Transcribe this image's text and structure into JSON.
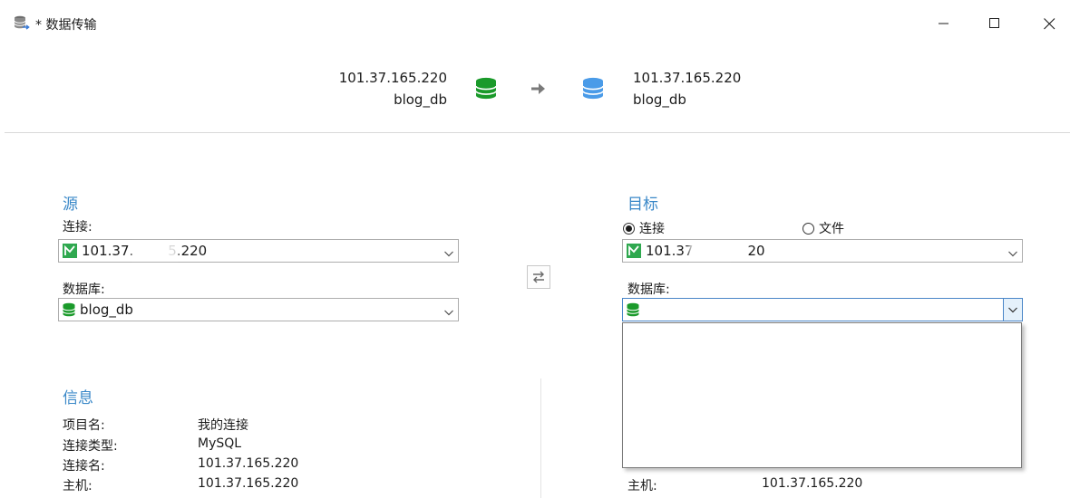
{
  "window": {
    "title": "* 数据传输",
    "minimize_glyph": "—",
    "maximize_glyph": "☐",
    "close_glyph": "✕"
  },
  "header": {
    "source_host": "101.37.165.220",
    "source_db": "blog_db",
    "target_host": "101.37.165.220",
    "target_db": "blog_db",
    "source_db_color": "#1a9a2a",
    "target_db_color": "#4a9be8"
  },
  "source": {
    "title": "源",
    "connection_label": "连接:",
    "connection_value_visible_start": "101.37.",
    "connection_value_visible_end": "5.220",
    "database_label": "数据库:",
    "database_value": "blog_db"
  },
  "target": {
    "title": "目标",
    "radio_connection": "连接",
    "radio_file": "文件",
    "radio_selected": "连接",
    "connection_value_visible_start": "101.37",
    "connection_value_visible_end": "20",
    "database_label": "数据库:",
    "database_value": ""
  },
  "info": {
    "title": "信息",
    "rows": [
      {
        "label": "项目名:",
        "value": "我的连接"
      },
      {
        "label": "连接类型:",
        "value": "MySQL"
      },
      {
        "label": "连接名:",
        "value": "101.37.165.220"
      },
      {
        "label": "主机:",
        "value": "101.37.165.220"
      }
    ]
  },
  "target_info": {
    "rows": [
      {
        "label": "主机:",
        "value": "101.37.165.220"
      }
    ]
  },
  "icons": {
    "app": "database-transfer-icon",
    "mysql": "mysql-connection-icon",
    "database": "database-icon",
    "arrow": "arrow-right-icon",
    "swap": "swap-icon",
    "chevron": "chevron-down-icon"
  },
  "colors": {
    "accent": "#3a88c8",
    "db_green": "#1a9a2a",
    "db_blue": "#4a9be8",
    "mysql_green": "#2fa84f"
  }
}
